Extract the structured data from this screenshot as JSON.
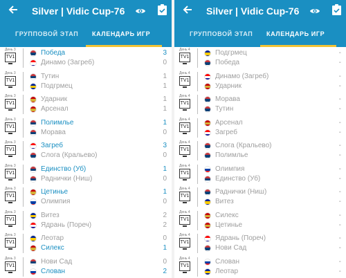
{
  "colors": {
    "appbar": "#1a8fc2",
    "accent": "#f2c335",
    "win": "#1a8fc2",
    "muted": "#9e9e9e"
  },
  "flags": {
    "SRB": [
      "#c6363c",
      "#0c4076",
      "#ffffff"
    ],
    "CRO": [
      "#ff0000",
      "#ffffff",
      "#171796"
    ],
    "BIH": [
      "#002395",
      "#fecb00",
      "#002395"
    ],
    "MNE": [
      "#c40308",
      "#d4af37",
      "#c40308"
    ],
    "SLO": [
      "#ffffff",
      "#003da5",
      "#ed1c24"
    ]
  },
  "left": {
    "title": "Silver | Vidic Cup-76",
    "icons": {
      "back": "back-arrow-icon",
      "eye": "eye-icon",
      "clip": "clipboard-check-icon"
    },
    "tabs": [
      {
        "label": "ГРУППОВОЙ ЭТАП",
        "active": false
      },
      {
        "label": "КАЛЕНДАРЬ ИГР",
        "active": true
      }
    ],
    "matches": [
      {
        "day": "День 3",
        "tv": "TV1",
        "home": {
          "name": "Победа",
          "flag": "SRB",
          "score": "3",
          "win": true
        },
        "away": {
          "name": "Динамо (Загреб)",
          "flag": "CRO",
          "score": "0",
          "win": false
        }
      },
      {
        "day": "День 3",
        "tv": "TV1",
        "home": {
          "name": "Тутин",
          "flag": "SRB",
          "score": "1",
          "win": false
        },
        "away": {
          "name": "Подгрмец",
          "flag": "BIH",
          "score": "1",
          "win": false
        }
      },
      {
        "day": "День 3",
        "tv": "TV1",
        "home": {
          "name": "Ударник",
          "flag": "MNE",
          "score": "1",
          "win": false
        },
        "away": {
          "name": "Арсенал",
          "flag": "MNE",
          "score": "1",
          "win": false
        }
      },
      {
        "day": "День 3",
        "tv": "TV1",
        "home": {
          "name": "Полимлье",
          "flag": "SRB",
          "score": "1",
          "win": true
        },
        "away": {
          "name": "Морава",
          "flag": "SRB",
          "score": "0",
          "win": false
        }
      },
      {
        "day": "День 3",
        "tv": "TV1",
        "home": {
          "name": "Загреб",
          "flag": "CRO",
          "score": "3",
          "win": true
        },
        "away": {
          "name": "Слога (Кральево)",
          "flag": "SRB",
          "score": "0",
          "win": false
        }
      },
      {
        "day": "День 3",
        "tv": "TV1",
        "home": {
          "name": "Единство (Уб)",
          "flag": "SRB",
          "score": "1",
          "win": true
        },
        "away": {
          "name": "Раднички (Ниш)",
          "flag": "SRB",
          "score": "0",
          "win": false
        }
      },
      {
        "day": "День 3",
        "tv": "TV1",
        "home": {
          "name": "Цетинье",
          "flag": "MNE",
          "score": "1",
          "win": true
        },
        "away": {
          "name": "Олимпия",
          "flag": "SLO",
          "score": "0",
          "win": false
        }
      },
      {
        "day": "День 3",
        "tv": "TV1",
        "home": {
          "name": "Витез",
          "flag": "BIH",
          "score": "2",
          "win": false
        },
        "away": {
          "name": "Ядрань (Пореч)",
          "flag": "CRO",
          "score": "2",
          "win": false
        }
      },
      {
        "day": "День 3",
        "tv": "TV1",
        "home": {
          "name": "Леотар",
          "flag": "BIH",
          "score": "0",
          "win": false
        },
        "away": {
          "name": "Силекс",
          "flag": "MNE",
          "score": "1",
          "win": true
        }
      },
      {
        "day": "День 3",
        "tv": "TV1",
        "home": {
          "name": "Нови Сад",
          "flag": "SRB",
          "score": "0",
          "win": false
        },
        "away": {
          "name": "Слован",
          "flag": "SLO",
          "score": "2",
          "win": true
        }
      }
    ]
  },
  "right": {
    "title": "Silver | Vidic Cup-76",
    "icons": {
      "back": "back-arrow-icon",
      "eye": "eye-icon",
      "clip": "clipboard-check-icon"
    },
    "tabs": [
      {
        "label": "ГРУППОВОЙ ЭТАП",
        "active": false
      },
      {
        "label": "КАЛЕНДАРЬ ИГР",
        "active": true
      }
    ],
    "matches": [
      {
        "day": "День 4",
        "tv": "TV1",
        "home": {
          "name": "Подгрмец",
          "flag": "BIH",
          "score": "-",
          "win": false
        },
        "away": {
          "name": "Победа",
          "flag": "SRB",
          "score": "-",
          "win": false
        }
      },
      {
        "day": "День 4",
        "tv": "TV1",
        "home": {
          "name": "Динамо (Загреб)",
          "flag": "CRO",
          "score": "-",
          "win": false
        },
        "away": {
          "name": "Ударник",
          "flag": "MNE",
          "score": "-",
          "win": false
        }
      },
      {
        "day": "День 4",
        "tv": "TV1",
        "home": {
          "name": "Морава",
          "flag": "SRB",
          "score": "-",
          "win": false
        },
        "away": {
          "name": "Тутин",
          "flag": "SRB",
          "score": "-",
          "win": false
        }
      },
      {
        "day": "День 4",
        "tv": "TV1",
        "home": {
          "name": "Арсенал",
          "flag": "MNE",
          "score": "-",
          "win": false
        },
        "away": {
          "name": "Загреб",
          "flag": "CRO",
          "score": "-",
          "win": false
        }
      },
      {
        "day": "День 4",
        "tv": "TV1",
        "home": {
          "name": "Слога (Кральево)",
          "flag": "SRB",
          "score": "-",
          "win": false
        },
        "away": {
          "name": "Полимлье",
          "flag": "SRB",
          "score": "-",
          "win": false
        }
      },
      {
        "day": "День 4",
        "tv": "TV1",
        "home": {
          "name": "Олимпия",
          "flag": "SLO",
          "score": "-",
          "win": false
        },
        "away": {
          "name": "Единство (Уб)",
          "flag": "SRB",
          "score": "-",
          "win": false
        }
      },
      {
        "day": "День 4",
        "tv": "TV1",
        "home": {
          "name": "Раднички (Ниш)",
          "flag": "SRB",
          "score": "-",
          "win": false
        },
        "away": {
          "name": "Витез",
          "flag": "BIH",
          "score": "-",
          "win": false
        }
      },
      {
        "day": "День 4",
        "tv": "TV1",
        "home": {
          "name": "Силекс",
          "flag": "MNE",
          "score": "-",
          "win": false
        },
        "away": {
          "name": "Цетинье",
          "flag": "MNE",
          "score": "-",
          "win": false
        }
      },
      {
        "day": "День 4",
        "tv": "TV1",
        "home": {
          "name": "Ядрань (Пореч)",
          "flag": "CRO",
          "score": "-",
          "win": false
        },
        "away": {
          "name": "Нови Сад",
          "flag": "SRB",
          "score": "-",
          "win": false
        }
      },
      {
        "day": "День 4",
        "tv": "TV1",
        "home": {
          "name": "Слован",
          "flag": "SLO",
          "score": "-",
          "win": false
        },
        "away": {
          "name": "Леотар",
          "flag": "BIH",
          "score": "-",
          "win": false
        }
      }
    ]
  }
}
